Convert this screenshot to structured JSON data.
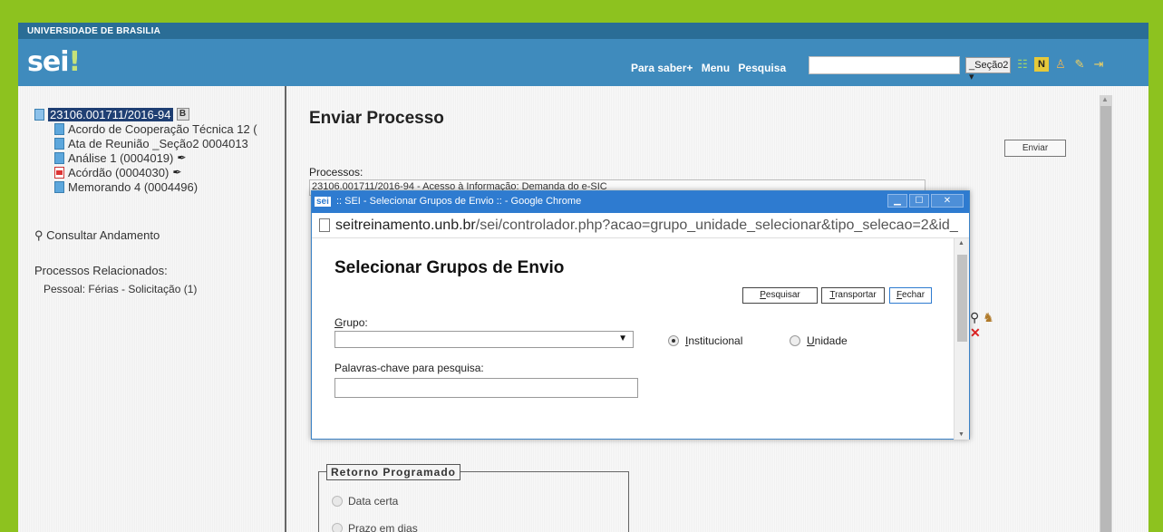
{
  "header": {
    "institution": "UNIVERSIDADE DE BRASILIA",
    "logo": "sei",
    "logo_bang": "!",
    "links": [
      "Para saber+",
      "Menu",
      "Pesquisa"
    ],
    "search_value": "",
    "unit_selected": "_Seção2",
    "icons": [
      "list-icon",
      "notes-icon",
      "user-icon",
      "tools-icon",
      "exit-icon"
    ]
  },
  "tree": {
    "process_number": "23106.001711/2016-94",
    "badge": "B",
    "documents": [
      {
        "label": "Acordo de Cooperação Técnica 12 (",
        "icon": "document-icon"
      },
      {
        "label": "Ata de Reunião _Seção2 0004013",
        "icon": "document-icon"
      },
      {
        "label": "Análise 1 (0004019)",
        "icon": "document-icon"
      },
      {
        "label": "Acórdão (0004030)",
        "icon": "pdf-icon"
      },
      {
        "label": "Memorando 4 (0004496)",
        "icon": "document-icon"
      }
    ],
    "consultar_label": "Consultar Andamento",
    "related_title": "Processos Relacionados:",
    "related_item": "Pessoal: Férias - Solicitação (1)"
  },
  "main": {
    "title": "Enviar Processo",
    "enviar_button": "Enviar",
    "processos_label": "Processos:",
    "processos_value": "23106.001711/2016-94 - Acesso à Informação: Demanda do e-SIC",
    "retorno_legend": "Retorno Programado",
    "retorno_options": [
      "Data certa",
      "Prazo em dias"
    ]
  },
  "popup": {
    "window_title": ":: SEI - Selecionar Grupos de Envio :: - Google Chrome",
    "window_icon_text": "sei",
    "url_host": "seitreinamento.unb.br",
    "url_path": "/sei/controlador.php?acao=grupo_unidade_selecionar&tipo_selecao=2&id_",
    "title": "Selecionar Grupos de Envio",
    "buttons": {
      "pesquisar_u": "P",
      "pesquisar_rest": "esquisar",
      "transportar_u": "T",
      "transportar_rest": "ransportar",
      "fechar_u": "F",
      "fechar_rest": "echar"
    },
    "grupo_label_u": "G",
    "grupo_label_rest": "rupo:",
    "grupo_value": "",
    "radio_institucional_u": "I",
    "radio_institucional_rest": "nstitucional",
    "radio_unidade_u": "U",
    "radio_unidade_rest": "nidade",
    "selected_radio": "Institucional",
    "palavras_label": "Palavras-chave para pesquisa:",
    "palavras_value": ""
  }
}
